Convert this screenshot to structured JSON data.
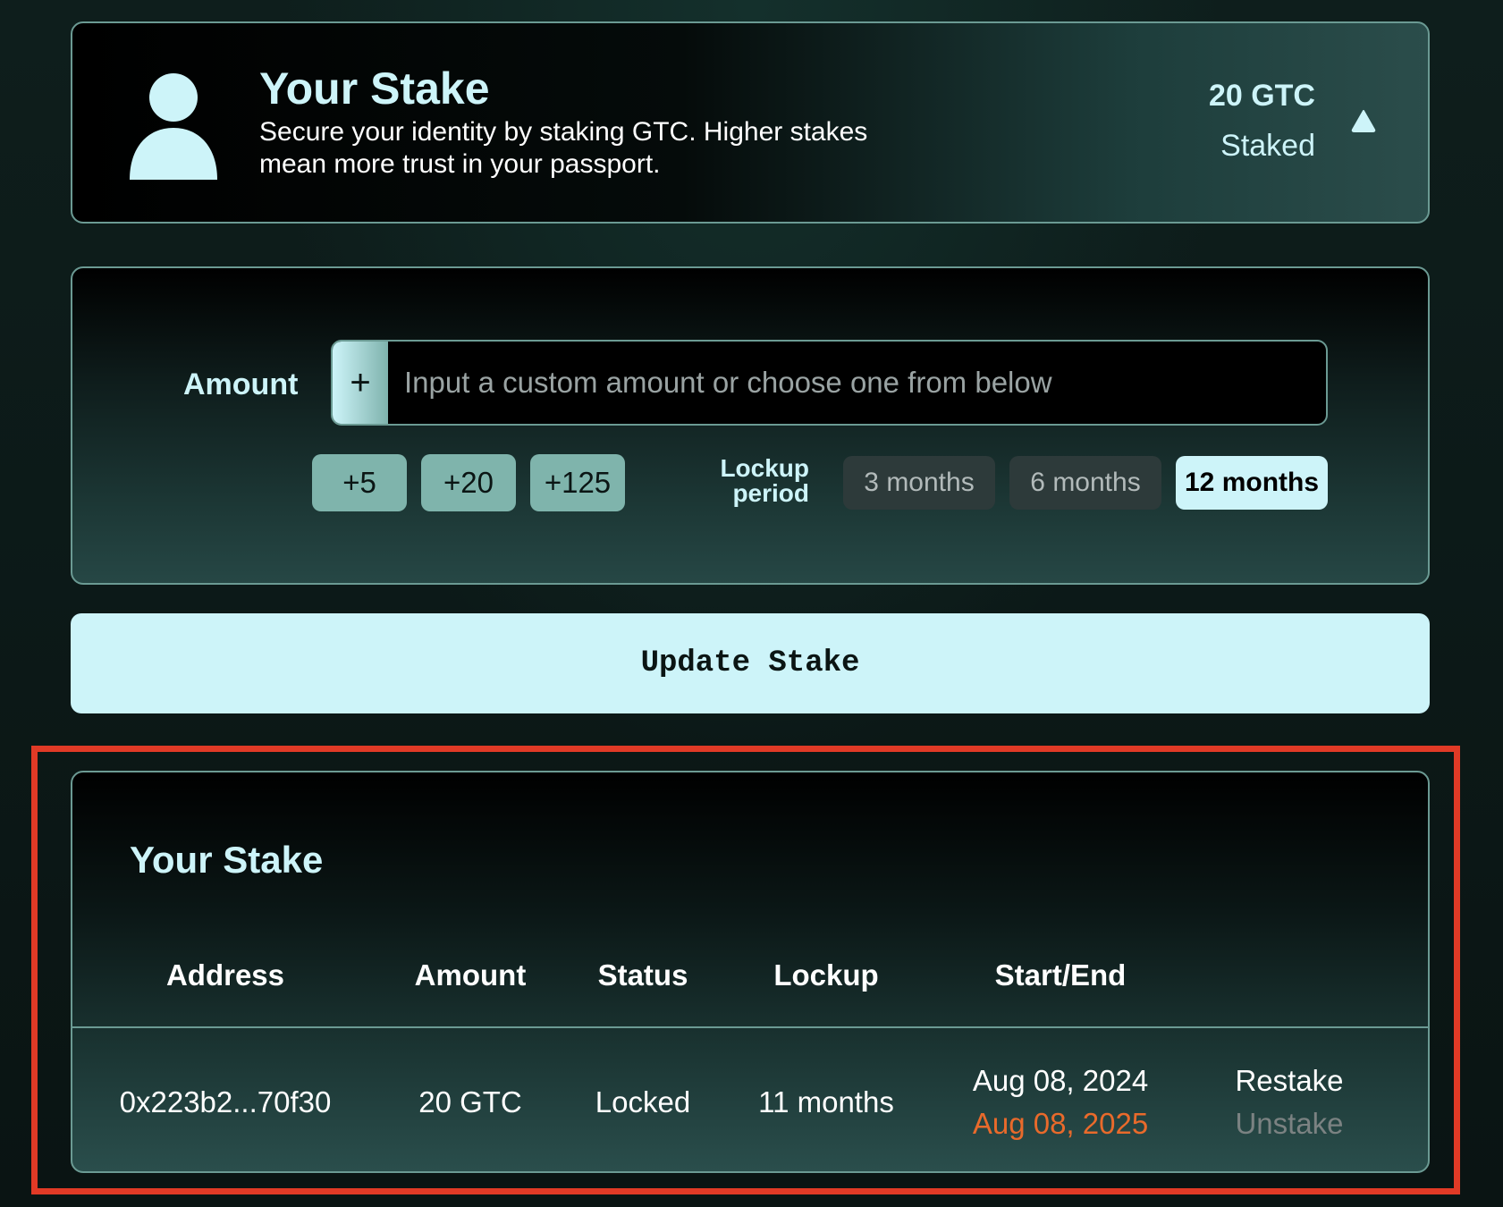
{
  "header": {
    "title": "Your Stake",
    "description": "Secure your identity by staking GTC. Higher stakes mean more trust in your passport.",
    "staked_amount": "20 GTC",
    "staked_label": "Staked",
    "icons": {
      "avatar": "person-icon",
      "toggle": "triangle-up-icon"
    }
  },
  "amount_form": {
    "label": "Amount",
    "plus_symbol": "+",
    "placeholder": "Input a custom amount or choose one from below",
    "quick_amounts": [
      "+5",
      "+20",
      "+125"
    ],
    "lockup_label": "Lockup period",
    "lockup_options": [
      "3 months",
      "6 months",
      "12 months"
    ],
    "selected_lockup": "12 months"
  },
  "update_button": "Update Stake",
  "stake_table": {
    "title": "Your Stake",
    "columns": [
      "Address",
      "Amount",
      "Status",
      "Lockup",
      "Start/End"
    ],
    "rows": [
      {
        "address": "0x223b2...70f30",
        "amount": "20 GTC",
        "status": "Locked",
        "lockup": "11 months",
        "start": "Aug 08, 2024",
        "end": "Aug 08, 2025",
        "actions": [
          "Restake",
          "Unstake"
        ]
      }
    ]
  },
  "colors": {
    "accent": "#cdf4f9",
    "quick_button": "#7fb4ac",
    "end_date": "#e96a2b",
    "highlight": "#e13a26",
    "disabled": "#7b8282"
  }
}
